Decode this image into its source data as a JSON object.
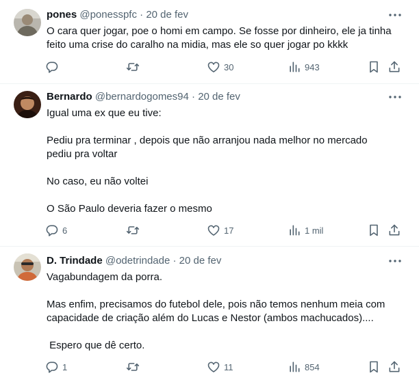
{
  "tweets": [
    {
      "name": "pones",
      "handle": "@ponesspfc",
      "separator": "·",
      "date": "20 de fev",
      "lines": [
        "O cara quer jogar, poe o homi em campo. Se fosse por dinheiro, ele ja tinha",
        "feito uma crise do caralho na midia, mas ele so quer jogar po kkkk"
      ],
      "replies": "",
      "retweets": "",
      "likes": "30",
      "views": "943"
    },
    {
      "name": "Bernardo",
      "handle": "@bernardogomes94",
      "separator": "·",
      "date": "20 de fev",
      "lines": [
        "Igual uma ex que eu tive:",
        "",
        "Pediu pra terminar , depois que não arranjou nada melhor no mercado",
        "pediu pra voltar",
        "",
        "No caso, eu não voltei",
        "",
        "O São Paulo deveria fazer o mesmo"
      ],
      "replies": "6",
      "retweets": "",
      "likes": "17",
      "views": "1 mil"
    },
    {
      "name": "D. Trindade",
      "handle": "@odetrindade",
      "separator": "·",
      "date": "20 de fev",
      "lines": [
        "Vagabundagem da porra.",
        "",
        "Mas enfim, precisamos do futebol dele, pois não temos nenhum meia com",
        "capacidade de criação além do Lucas e Nestor (ambos machucados)....",
        "",
        " Espero que dê certo."
      ],
      "replies": "1",
      "retweets": "",
      "likes": "11",
      "views": "854"
    }
  ],
  "icons": {
    "reply": "reply-icon",
    "retweet": "retweet-icon",
    "like": "heart-icon",
    "views": "views-bar-chart-icon",
    "bookmark": "bookmark-icon",
    "share": "share-icon",
    "more": "more-horizontal-icon"
  },
  "colors": {
    "text": "#0f1419",
    "secondary": "#536471",
    "separator": "#eff3f4"
  }
}
